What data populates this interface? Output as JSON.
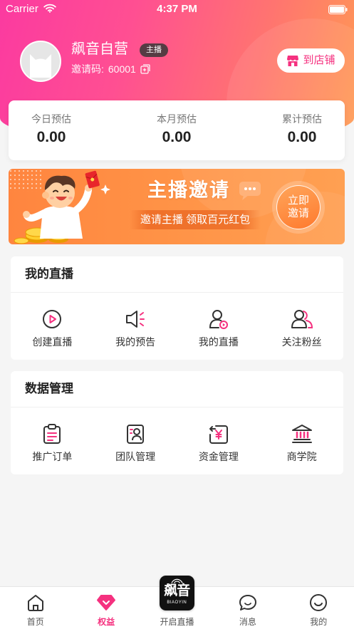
{
  "status_bar": {
    "carrier": "Carrier",
    "time": "4:37 PM"
  },
  "profile": {
    "name": "飙音自营",
    "badge": "主播",
    "invite_label": "邀请码:",
    "invite_code": "60001",
    "store_button": "到店铺"
  },
  "stats": [
    {
      "label": "今日预估",
      "value": "0.00"
    },
    {
      "label": "本月预估",
      "value": "0.00"
    },
    {
      "label": "累计预估",
      "value": "0.00"
    }
  ],
  "banner": {
    "title": "主播邀请",
    "subtitle": "邀请主播 领取百元红包",
    "cta_line1": "立即",
    "cta_line2": "邀请"
  },
  "live_section": {
    "title": "我的直播",
    "items": [
      {
        "label": "创建直播",
        "icon": "play-circle-icon"
      },
      {
        "label": "我的预告",
        "icon": "megaphone-icon"
      },
      {
        "label": "我的直播",
        "icon": "user-live-icon"
      },
      {
        "label": "关注粉丝",
        "icon": "followers-icon"
      }
    ]
  },
  "data_section": {
    "title": "数据管理",
    "items": [
      {
        "label": "推广订单",
        "icon": "clipboard-icon"
      },
      {
        "label": "团队管理",
        "icon": "team-card-icon"
      },
      {
        "label": "资金管理",
        "icon": "yen-icon"
      },
      {
        "label": "商学院",
        "icon": "bank-icon"
      }
    ]
  },
  "tab_bar": {
    "items": [
      {
        "label": "首页",
        "icon": "home-icon",
        "active": false
      },
      {
        "label": "权益",
        "icon": "benefits-icon",
        "active": true
      },
      {
        "label": "开启直播",
        "icon": "app-logo",
        "active": false
      },
      {
        "label": "消息",
        "icon": "message-icon",
        "active": false
      },
      {
        "label": "我的",
        "icon": "profile-icon",
        "active": false
      }
    ],
    "center_logo": {
      "text": "飙音",
      "subtext": "BIAOYIN"
    }
  },
  "colors": {
    "accent": "#f5317f",
    "header_start": "#fb3aa0",
    "header_end": "#ff9b52",
    "banner": "#ff8c44",
    "page_background": "#f5f5f5"
  }
}
